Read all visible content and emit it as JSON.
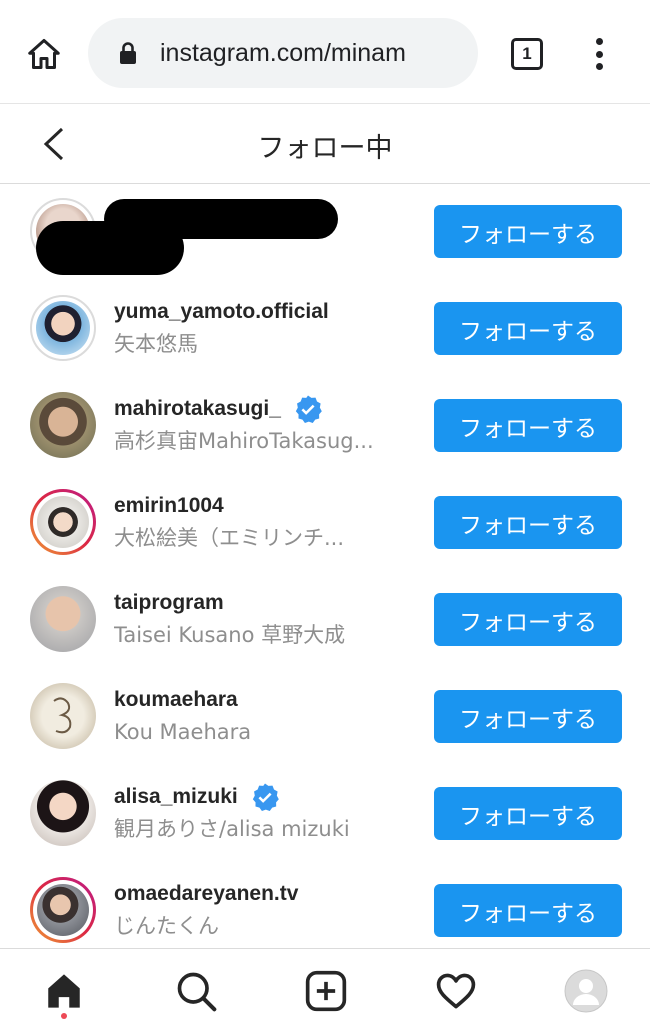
{
  "browser": {
    "url": "instagram.com/minam",
    "tab_count": "1",
    "home_icon": "home-icon",
    "lock_icon": "lock-icon",
    "menu_icon": "more-vert-icon"
  },
  "header": {
    "title": "フォロー中",
    "back_icon": "chevron-left-icon"
  },
  "follow_button_label": "フォローする",
  "accounts": [
    {
      "username": "",
      "full_name": "",
      "verified": false,
      "story_ring": false,
      "redacted": true
    },
    {
      "username": "yuma_yamoto.official",
      "full_name": "矢本悠馬",
      "verified": false,
      "story_ring": false
    },
    {
      "username": "mahirotakasugi_",
      "full_name": "高杉真宙MahiroTakasug...",
      "verified": true,
      "story_ring": false
    },
    {
      "username": "emirin1004",
      "full_name": "大松絵美（エミリンチ...",
      "verified": false,
      "story_ring": true
    },
    {
      "username": "taiprogram",
      "full_name": "Taisei Kusano 草野大成",
      "verified": false,
      "story_ring": false
    },
    {
      "username": "koumaehara",
      "full_name": "Kou Maehara",
      "verified": false,
      "story_ring": false
    },
    {
      "username": "alisa_mizuki",
      "full_name": "観月ありさ/alisa mizuki",
      "verified": true,
      "story_ring": false
    },
    {
      "username": "omaedareyanen.tv",
      "full_name": "じんたくん",
      "verified": false,
      "story_ring": true
    }
  ],
  "bottom_nav": [
    "home-icon",
    "search-icon",
    "new-post-icon",
    "activity-heart-icon",
    "profile-avatar-icon"
  ],
  "colors": {
    "accent": "#1a95f0",
    "text": "#262626",
    "secondary_text": "#8e8e8e",
    "verified": "#3897f0"
  }
}
